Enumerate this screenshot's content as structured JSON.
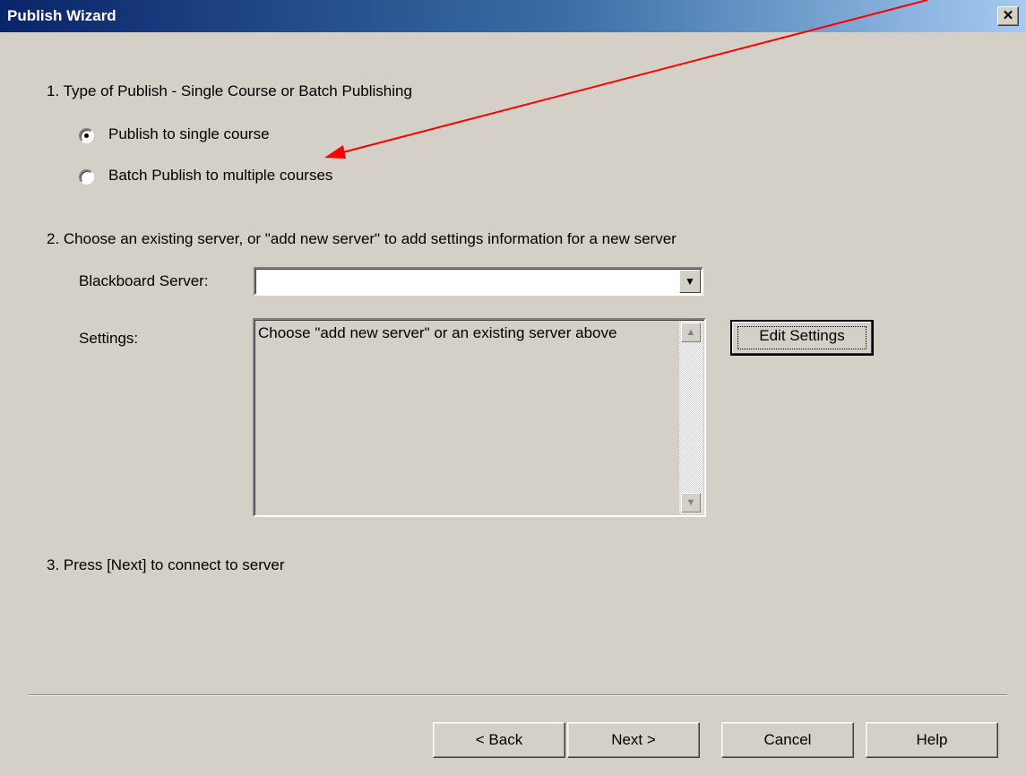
{
  "window": {
    "title": "Publish Wizard",
    "close_glyph": "✕"
  },
  "step1": {
    "heading": "1.  Type of Publish - Single Course or Batch Publishing",
    "options": [
      {
        "label": "Publish to single course",
        "selected": true
      },
      {
        "label": "Batch Publish to multiple courses",
        "selected": false
      }
    ]
  },
  "step2": {
    "heading": "2.  Choose an existing server, or \"add new server\" to add settings information for a new server",
    "server_label": "Blackboard Server:",
    "server_value": "",
    "settings_label": "Settings:",
    "settings_text": "Choose \"add new server\" or an existing server above",
    "edit_settings": "Edit Settings"
  },
  "step3": {
    "heading": "3.  Press [Next] to connect to server"
  },
  "buttons": {
    "back": "< Back",
    "next": "Next >",
    "cancel": "Cancel",
    "help": "Help"
  },
  "annotation": {
    "arrow_color": "#ff0000",
    "icon": "annotation-arrow-icon"
  }
}
